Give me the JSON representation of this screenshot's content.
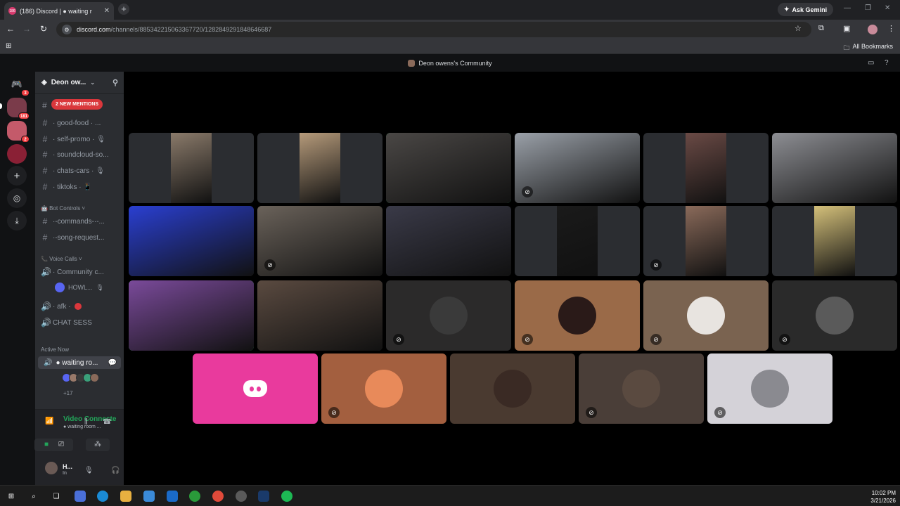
{
  "browser": {
    "tab_title": "(186) Discord | ● waiting r",
    "tab_favicon_text": "186",
    "close_glyph": "✕",
    "new_tab_glyph": "+",
    "gemini_label": "Ask Gemini",
    "url_domain": "discord.com",
    "url_path": "/channels/885342215063367720/1282849291848646687",
    "all_bookmarks": "All Bookmarks"
  },
  "discord": {
    "window_title": "Deon owens's Community",
    "server_rail": [
      {
        "name": "discord-home-icon",
        "badge": "3",
        "color": "#111214"
      },
      {
        "name": "server-icon-1",
        "badge": "181",
        "color": "#7a3b4a"
      },
      {
        "name": "server-icon-2",
        "badge": "2",
        "color": "#c45a6a"
      },
      {
        "name": "server-icon-3",
        "badge": "",
        "color": "#8a2035"
      }
    ],
    "guild_name": "Deon ow...",
    "new_mentions": "2 NEW MENTIONS",
    "channels": [
      {
        "label": "· good-food · ..."
      },
      {
        "label": "· self-promo · 🎙"
      },
      {
        "label": "· soundcloud-so..."
      },
      {
        "label": "· chats-cars · 🎙"
      },
      {
        "label": "· tiktoks · 📱"
      }
    ],
    "bot_controls_category": "🤖 Bot Controls ˅",
    "bot_channels": [
      {
        "label": "·-commands-·-..."
      },
      {
        "label": "·-song-request..."
      }
    ],
    "voice_category": "📞 Voice Calls ˅",
    "voice_channel_community": "· Community c...",
    "voice_member": "HOWL...",
    "afk_channel": "· afk ·",
    "chat_sess": "CHAT SESS",
    "active_now": "Active Now",
    "waiting_room": "● waiting ro...",
    "plus_count": "+17",
    "voice_connected": "Video Connecte",
    "voice_sub": "● waiting room ...",
    "user_name": "H...",
    "user_status": "In"
  },
  "stage_tiles": [
    {
      "name": "participant-tile-1",
      "bg": "#2b2d31",
      "vid": "#8a7a6a",
      "mode": "portrait",
      "muted": false,
      "speaking": false
    },
    {
      "name": "participant-tile-2",
      "bg": "#2b2d31",
      "vid": "#b59a7a",
      "mode": "portrait",
      "muted": false,
      "speaking": false
    },
    {
      "name": "participant-tile-3",
      "bg": "#2b2d31",
      "vid": "#4a4745",
      "mode": "full",
      "muted": false,
      "speaking": true
    },
    {
      "name": "participant-tile-4",
      "bg": "#2b2d31",
      "vid": "#9aa0a8",
      "mode": "full",
      "muted": true,
      "speaking": false
    },
    {
      "name": "participant-tile-5",
      "bg": "#2b2d31",
      "vid": "#6a4a45",
      "mode": "portrait",
      "muted": false,
      "speaking": false
    },
    {
      "name": "participant-tile-6",
      "bg": "#2b2d31",
      "vid": "#8d8e93",
      "mode": "full",
      "muted": false,
      "speaking": false
    },
    {
      "name": "participant-tile-7",
      "bg": "#2b2d31",
      "vid": "#2a3fd1",
      "mode": "full",
      "muted": false,
      "speaking": false
    },
    {
      "name": "participant-tile-8",
      "bg": "#2b2d31",
      "vid": "#6a625a",
      "mode": "full",
      "muted": true,
      "speaking": false
    },
    {
      "name": "participant-tile-9",
      "bg": "#2b2d31",
      "vid": "#3a3a48",
      "mode": "full",
      "muted": false,
      "speaking": false
    },
    {
      "name": "participant-tile-10",
      "bg": "#2b2d31",
      "vid": "#1a1a1a",
      "mode": "portrait",
      "muted": false,
      "speaking": false
    },
    {
      "name": "participant-tile-11",
      "bg": "#2b2d31",
      "vid": "#8a6a5a",
      "mode": "portrait",
      "muted": true,
      "speaking": false
    },
    {
      "name": "participant-tile-12",
      "bg": "#2b2d31",
      "vid": "#d4c07a",
      "mode": "portrait",
      "muted": false,
      "speaking": false
    },
    {
      "name": "participant-tile-13",
      "bg": "#2b2d31",
      "vid": "#7a4a9a",
      "mode": "full",
      "muted": false,
      "speaking": true
    },
    {
      "name": "participant-tile-14",
      "bg": "#2b2d31",
      "vid": "#5a4a40",
      "mode": "full",
      "muted": false,
      "speaking": false
    },
    {
      "name": "participant-tile-15",
      "bg": "#2b2a2a",
      "face": "#3a3a3a",
      "mode": "avatar",
      "muted": true,
      "speaking": false
    },
    {
      "name": "participant-tile-16",
      "bg": "#9a6a48",
      "face": "#2a1a18",
      "mode": "avatar",
      "muted": true,
      "speaking": false
    },
    {
      "name": "participant-tile-17",
      "bg": "#7a6350",
      "face": "#e8e4e0",
      "mode": "avatar",
      "muted": true,
      "speaking": false
    },
    {
      "name": "participant-tile-18",
      "bg": "#2a2a2a",
      "face": "#5a5a5a",
      "mode": "avatar",
      "muted": true,
      "speaking": false
    },
    {
      "name": "participant-tile-19",
      "bg": "#e93a9d",
      "mode": "discord",
      "muted": false,
      "speaking": false
    },
    {
      "name": "participant-tile-20",
      "bg": "#a35f3f",
      "face": "#e88a5a",
      "mode": "avatar",
      "muted": true,
      "speaking": false
    },
    {
      "name": "participant-tile-21",
      "bg": "#4a3a30",
      "face": "#3a2a24",
      "mode": "avatar",
      "muted": false,
      "speaking": false
    },
    {
      "name": "participant-tile-22",
      "bg": "#4a3e38",
      "face": "#5a4a40",
      "mode": "avatar",
      "muted": true,
      "speaking": false
    },
    {
      "name": "participant-tile-23",
      "bg": "#d4d2d8",
      "face": "#8a8a90",
      "mode": "avatar",
      "muted": true,
      "speaking": false
    }
  ],
  "taskbar": {
    "time": "10:02 PM",
    "date": "3/21/2026"
  }
}
